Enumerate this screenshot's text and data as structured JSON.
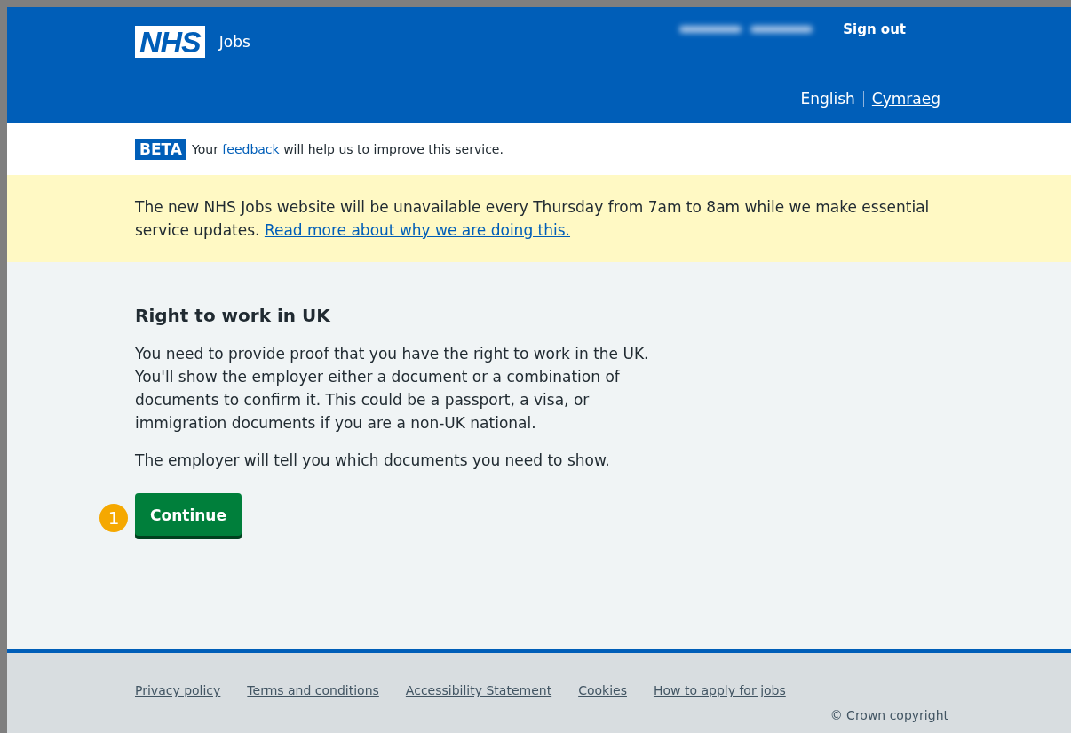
{
  "header": {
    "logo": "NHS",
    "service": "Jobs",
    "sign_out": "Sign out",
    "languages": [
      {
        "label": "English",
        "selected": true
      },
      {
        "label": "Cymraeg",
        "selected": false
      }
    ]
  },
  "phase_banner": {
    "tag": "BETA",
    "text_before": "Your",
    "link": "feedback",
    "text_after": "will help us to improve this service."
  },
  "notice": {
    "text": "The new NHS Jobs website will be unavailable every Thursday from 7am to 8am while we make essential service updates.",
    "link": "Read more about why we are doing this."
  },
  "main": {
    "heading": "Right to work in UK",
    "paragraphs": [
      "You need to provide proof that you have the right to work in the UK. You'll show the employer either a document or a combination of documents to confirm it. This could be a passport, a visa, or immigration documents if you are a non-UK national.",
      "The employer will tell you which documents you need to show."
    ],
    "button": "Continue",
    "callout": "1"
  },
  "footer": {
    "links": [
      "Privacy policy",
      "Terms and conditions",
      "Accessibility Statement",
      "Cookies",
      "How to apply for jobs"
    ],
    "copyright": "© Crown copyright"
  }
}
